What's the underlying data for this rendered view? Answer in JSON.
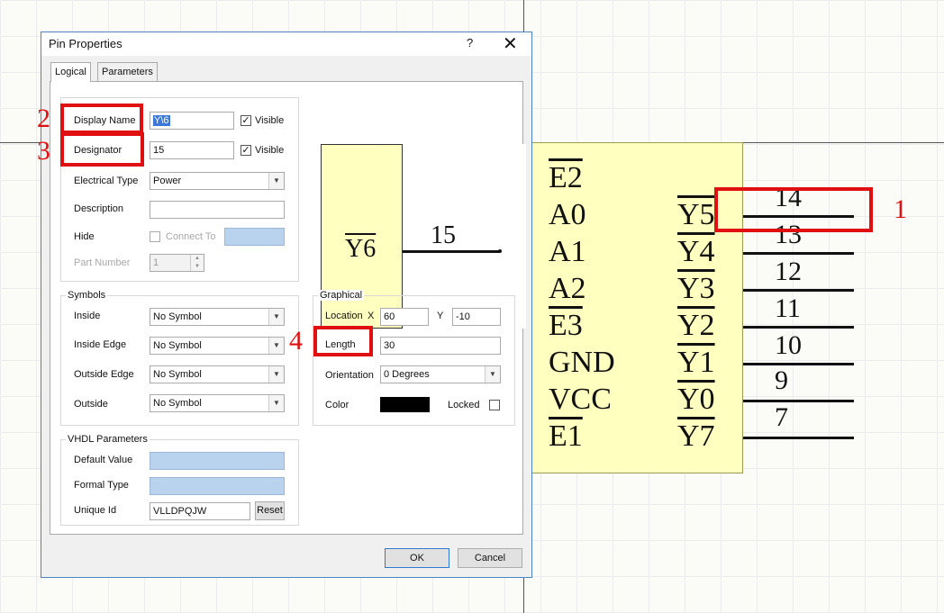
{
  "schematic": {
    "left_labels": [
      {
        "text": "E2",
        "overline": true
      },
      {
        "text": "A0",
        "overline": false
      },
      {
        "text": "A1",
        "overline": false
      },
      {
        "text": "A2",
        "overline": false
      },
      {
        "text": "E3",
        "overline": true
      },
      {
        "text": "GND",
        "overline": false
      },
      {
        "text": "VCC",
        "overline": false
      },
      {
        "text": "E1",
        "overline": true
      }
    ],
    "right_labels": [
      "Y5",
      "Y4",
      "Y3",
      "Y2",
      "Y1",
      "Y0",
      "Y7"
    ],
    "pin_numbers": [
      "14",
      "13",
      "12",
      "11",
      "10",
      "9",
      "7"
    ]
  },
  "annotations": [
    "1",
    "2",
    "3",
    "4"
  ],
  "dialog": {
    "title": "Pin Properties",
    "help": "?",
    "close": "✕",
    "tabs": [
      "Logical",
      "Parameters"
    ],
    "fields": {
      "display_name_label": "Display Name",
      "display_name_value": "Y\\6",
      "visible_label": "Visible",
      "designator_label": "Designator",
      "designator_value": "15",
      "electrical_type_label": "Electrical Type",
      "electrical_type_value": "Power",
      "description_label": "Description",
      "description_value": "",
      "hide_label": "Hide",
      "connect_to_label": "Connect To",
      "part_number_label": "Part Number",
      "part_number_value": "1"
    },
    "symbols": {
      "title": "Symbols",
      "rows": [
        {
          "label": "Inside",
          "value": "No Symbol"
        },
        {
          "label": "Inside Edge",
          "value": "No Symbol"
        },
        {
          "label": "Outside Edge",
          "value": "No Symbol"
        },
        {
          "label": "Outside",
          "value": "No Symbol"
        }
      ]
    },
    "graphical": {
      "title": "Graphical",
      "location_label": "Location",
      "x_label": "X",
      "x_value": "60",
      "y_label": "Y",
      "y_value": "-10",
      "length_label": "Length",
      "length_value": "30",
      "orientation_label": "Orientation",
      "orientation_value": "0 Degrees",
      "color_label": "Color",
      "color_value": "#000000",
      "locked_label": "Locked"
    },
    "vhdl": {
      "title": "VHDL Parameters",
      "default_value_label": "Default Value",
      "formal_type_label": "Formal Type",
      "unique_id_label": "Unique Id",
      "unique_id_value": "VLLDPQJW",
      "reset_label": "Reset"
    },
    "preview": {
      "pin_name": "Y6",
      "pin_number": "15"
    },
    "ok_label": "OK",
    "cancel_label": "Cancel"
  }
}
